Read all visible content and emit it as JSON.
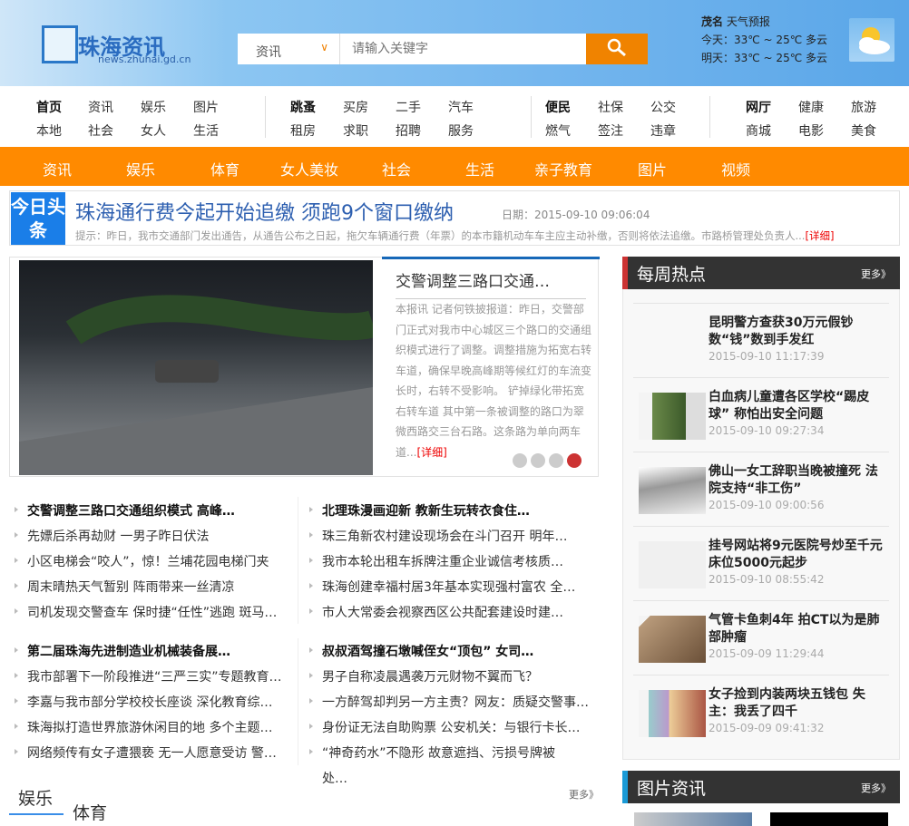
{
  "header": {
    "logo_text": "珠海资讯",
    "logo_url": "news.zhuhai.gd.cn",
    "search_category": "资讯",
    "search_placeholder": "请输入关键字",
    "weather": {
      "title_city": "茂名",
      "title": "天气预报",
      "today": "今天：33℃ ~ 25℃ 多云",
      "tomorrow": "明天：33℃ ~ 25℃ 多云"
    }
  },
  "nav_groups": [
    [
      [
        "首页",
        "资讯",
        "娱乐",
        "图片"
      ],
      [
        "本地",
        "社会",
        "女人",
        "生活"
      ]
    ],
    [
      [
        "跳蚤",
        "买房",
        "二手",
        "汽车"
      ],
      [
        "租房",
        "求职",
        "招聘",
        "服务"
      ]
    ],
    [
      [
        "便民",
        "社保",
        "公交"
      ],
      [
        "燃气",
        "签注",
        "违章"
      ]
    ],
    [
      [
        "网厅",
        "健康",
        "旅游"
      ],
      [
        "商城",
        "电影",
        "美食"
      ]
    ]
  ],
  "orange_nav": [
    "资讯",
    "娱乐",
    "体育",
    "女人美妆",
    "社会",
    "生活",
    "亲子教育",
    "图片",
    "视频"
  ],
  "headline": {
    "label": "今日头条",
    "title": "珠海通行费今起开始追缴  须跑9个窗口缴纳",
    "date": "日期：2015-09-10 09:06:04",
    "summary": "提示：昨日，我市交通部门发出通告，从通告公布之日起，拖欠车辆通行费（年票）的本市籍机动车车主应主动补缴，否则将依法追缴。市路桥管理处负责人...",
    "more": "[详细]"
  },
  "slide": {
    "title": "交警调整三路口交通…",
    "text": "本报讯  记者何铁披报道：昨日，交警部门正式对我市中心城区三个路口的交通组织模式进行了调整。调整措施为拓宽右转车道，确保早晚高峰期等候红灯的车流变长时，右转不受影响。         铲掉绿化带拓宽右转车道         其中第一条被调整的路口为翠微西路交三台石路。这条路为单向两车道...",
    "more": "[详细]",
    "active_dot": 4,
    "dots": 4
  },
  "lists": [
    [
      "交警调整三路口交通组织模式 高峰…",
      "先嫖后杀再劫财 一男子昨日伏法",
      "小区电梯会“咬人”，惊！兰埔花园电梯门夹",
      "周末晴热天气暂别 阵雨带来一丝清凉",
      "司机发现交警查车 保时捷“任性”逃跑 斑马…"
    ],
    [
      "北理珠漫画迎新 教新生玩转衣食住…",
      "珠三角新农村建设现场会在斗门召开 明年…",
      "我市本轮出租车拆牌注重企业诚信考核质…",
      "珠海创建幸福村居3年基本实现强村富农 全…",
      "市人大常委会视察西区公共配套建设时建…"
    ],
    [
      "第二届珠海先进制造业机械装备展…",
      "我市部署下一阶段推进“三严三实”专题教育…",
      "李嘉与我市部分学校校长座谈 深化教育综…",
      "珠海拟打造世界旅游休闲目的地 多个主题…",
      "网络频传有女子遭猥亵 无一人愿意受访 警…"
    ],
    [
      "叔叔酒驾撞石墩喊侄女“顶包” 女司…",
      "男子自称凌晨遇袭万元财物不翼而飞？",
      "一方醉驾却判另一方主责？网友：质疑交警事…",
      "身份证无法自助购票 公安机关：与银行卡长…",
      "“神奇药水”不隐形 故意遮挡、污损号牌被",
      "处…"
    ]
  ],
  "tabs": {
    "active": "娱乐",
    "other": "体育",
    "more": "更多》"
  },
  "weekly": {
    "title": "每周热点",
    "more": "更多》",
    "items": [
      {
        "title": "昆明警方查获30万元假钞 数“钱”数到手发红",
        "date": "2015-09-10 11:17:39"
      },
      {
        "title": "白血病儿童遭各区学校“踢皮球” 称怕出安全问题",
        "date": "2015-09-10 09:27:34"
      },
      {
        "title": "佛山一女工辞职当晚被撞死 法院支持“非工伤”",
        "date": "2015-09-10 09:00:56"
      },
      {
        "title": "挂号网站将9元医院号炒至千元 床位5000元起步",
        "date": "2015-09-10 08:55:42"
      },
      {
        "title": "气管卡鱼刺4年 拍CT以为是肺部肿瘤",
        "date": "2015-09-09 11:29:44"
      },
      {
        "title": "女子捡到内装两块五钱包 失主：我丢了四千",
        "date": "2015-09-09 09:41:32"
      }
    ]
  },
  "photo_news": {
    "title": "图片资讯",
    "more": "更多》"
  },
  "colors": {
    "orange": "#ff8a00",
    "blue": "#1a7ee8",
    "dark": "#333333",
    "red": "#cc3333"
  }
}
